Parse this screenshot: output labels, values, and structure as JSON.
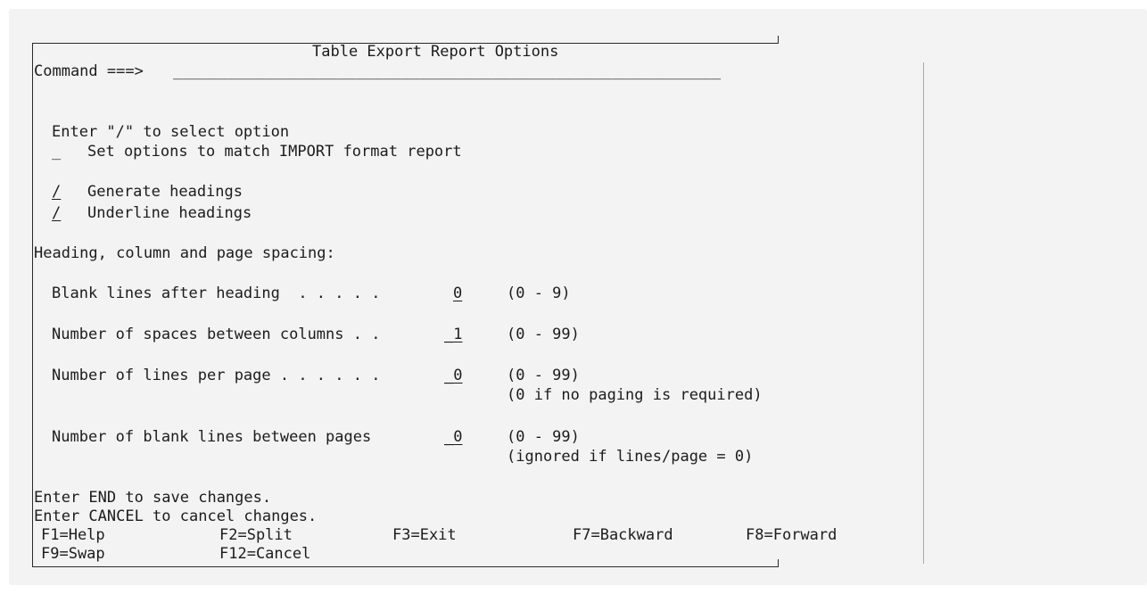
{
  "screen": {
    "title": "Table Export Report Options",
    "command_label": "Command ===>",
    "command_value": "____________________________________________________________"
  },
  "options": {
    "instruction": "Enter \"/\" to select option",
    "items": [
      {
        "mark": "_",
        "label": "Set options to match IMPORT format report"
      },
      {
        "mark": "/",
        "label": "Generate headings"
      },
      {
        "mark": "/",
        "label": "Underline headings"
      }
    ]
  },
  "spacing": {
    "heading": "Heading, column and page spacing:",
    "fields": [
      {
        "label": "Blank lines after heading  . . . . . ",
        "value": "0",
        "range": "(0 - 9)",
        "note": ""
      },
      {
        "label": "Number of spaces between columns . . ",
        "value": "_1",
        "range": "(0 - 99)",
        "note": ""
      },
      {
        "label": "Number of lines per page . . . . . . ",
        "value": "_0",
        "range": "(0 - 99)",
        "note": "(0 if no paging is required)"
      },
      {
        "label": "Number of blank lines between pages  ",
        "value": "_0",
        "range": "(0 - 99)",
        "note": "(ignored if lines/page = 0)"
      }
    ]
  },
  "messages": {
    "end": "Enter END to save changes.",
    "cancel": "Enter CANCEL to cancel changes."
  },
  "function_keys": [
    [
      "F1=Help",
      "F2=Split",
      "F3=Exit",
      "F7=Backward",
      "F8=Forward"
    ],
    [
      "F9=Swap",
      "F12=Cancel"
    ]
  ]
}
